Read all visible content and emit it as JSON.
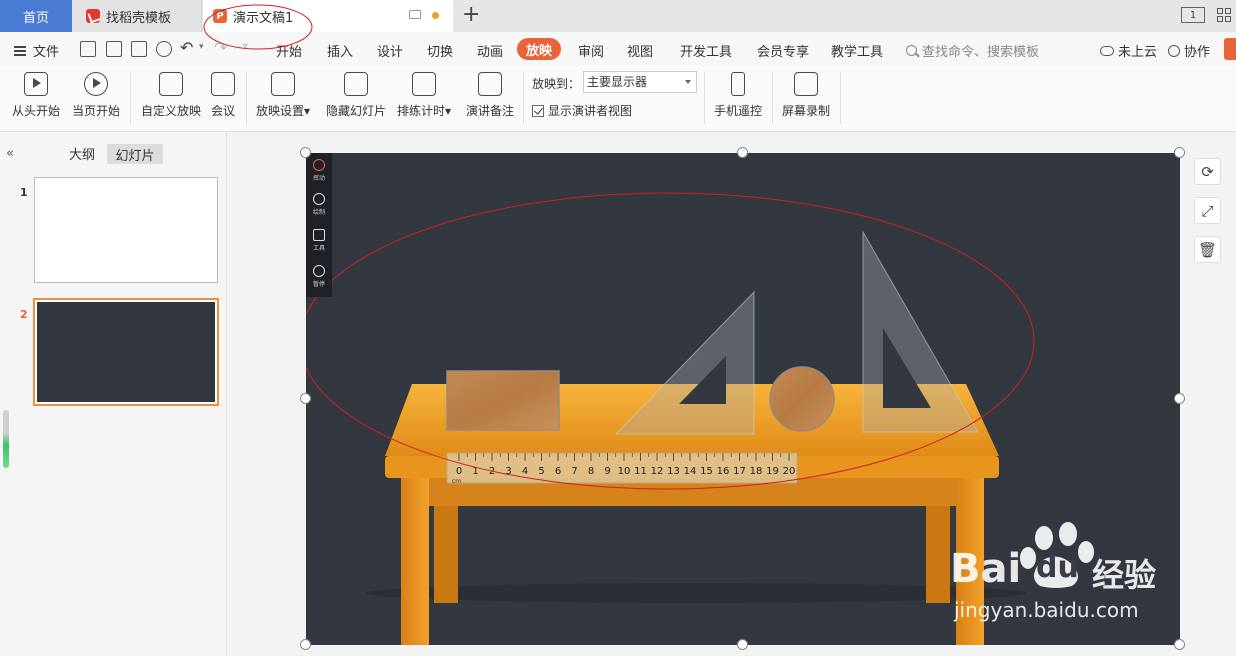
{
  "tabs": {
    "home": "首页",
    "template": "找稻壳模板",
    "document": "演示文稿1",
    "icon_find": "find-template-icon",
    "icon_doc": "ppt-file-icon",
    "ppt_glyph": "P"
  },
  "window": {
    "layout_label": "1"
  },
  "menu": {
    "file": "文件",
    "items": [
      "开始",
      "插入",
      "设计",
      "切换",
      "动画",
      "放映",
      "审阅",
      "视图",
      "开发工具",
      "会员专享",
      "教学工具"
    ],
    "active_index": 5,
    "search_placeholder": "查找命令、搜索模板",
    "cloud": "未上云",
    "collab": "协作"
  },
  "ribbon": {
    "from_start": "从头开始",
    "from_current": "当页开始",
    "custom_show": "自定义放映",
    "meeting": "会议",
    "show_settings": "放映设置",
    "hide_slide": "隐藏幻灯片",
    "rehearse": "排练计时",
    "speaker_notes": "演讲备注",
    "play_to_label": "放映到：",
    "play_to_value": "主要显示器",
    "presenter_view": "显示演讲者视图",
    "presenter_view_checked": true,
    "phone_remote": "手机遥控",
    "screen_record": "屏幕录制"
  },
  "panel": {
    "outline_tab": "大纲",
    "slides_tab": "幻灯片",
    "slides": [
      {
        "number": "1"
      },
      {
        "number": "2"
      }
    ],
    "active_slide": 2
  },
  "pen_tools": [
    "挥动",
    "绘制",
    "工具",
    "暂停"
  ],
  "ruler": {
    "unit": "cm",
    "ticks": [
      "0",
      "1",
      "2",
      "3",
      "4",
      "5",
      "6",
      "7",
      "8",
      "9",
      "10",
      "11",
      "12",
      "13",
      "14",
      "15",
      "16",
      "17",
      "18",
      "19",
      "20"
    ]
  },
  "watermark": {
    "brand1": "Bai",
    "brand2": "du",
    "brand3": "经验",
    "url": "jingyan.baidu.com"
  },
  "colors": {
    "accent": "#e8623a",
    "home_tab": "#4a7bd4",
    "slide_bg": "#333840",
    "annotation": "#cc2020"
  }
}
